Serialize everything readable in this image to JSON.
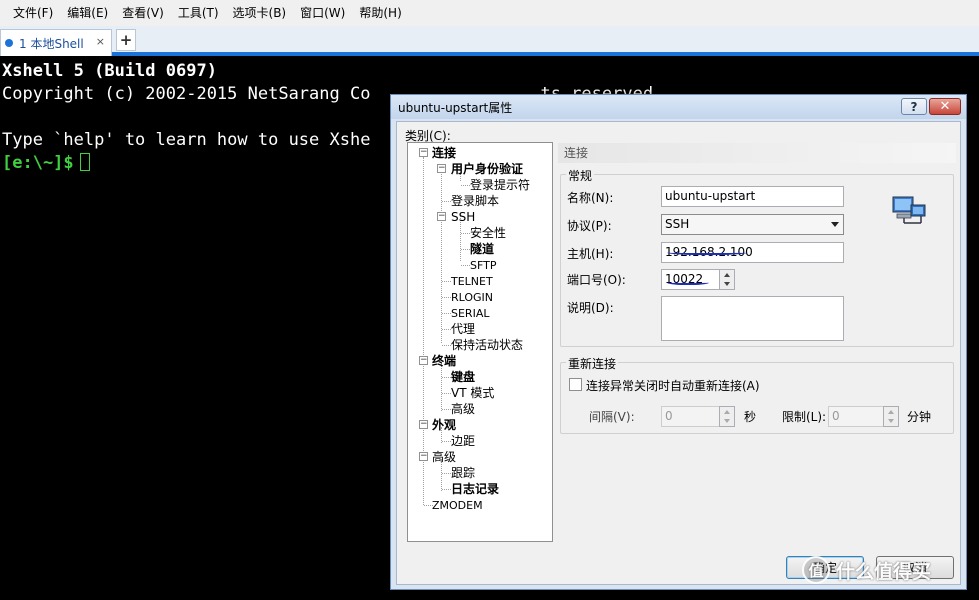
{
  "menu": [
    "文件(F)",
    "编辑(E)",
    "查看(V)",
    "工具(T)",
    "选项卡(B)",
    "窗口(W)",
    "帮助(H)"
  ],
  "tab": {
    "label": "1 本地Shell",
    "close": "×",
    "add": "+"
  },
  "terminal": {
    "line1": "Xshell 5 (Build 0697)",
    "line2": "Copyright (c) 2002-2015 NetSarang Co",
    "line2_tail": "ts reserved.",
    "line3": "Type `help' to learn how to use Xshe",
    "prompt": "[e:\\~]$"
  },
  "dialog": {
    "title": "ubuntu-upstart属性",
    "help": "?",
    "close": "✕",
    "category_label": "类别(C):",
    "tree": [
      "连接",
      "用户身份验证",
      "登录提示符",
      "登录脚本",
      "SSH",
      "安全性",
      "隧道",
      "SFTP",
      "TELNET",
      "RLOGIN",
      "SERIAL",
      "代理",
      "保持活动状态",
      "终端",
      "键盘",
      "VT 模式",
      "高级",
      "外观",
      "边距",
      "高级",
      "跟踪",
      "日志记录",
      "ZMODEM"
    ],
    "section_title": "连接",
    "general": {
      "title": "常规",
      "name_label": "名称(N):",
      "name_value": "ubuntu-upstart",
      "protocol_label": "协议(P):",
      "protocol_value": "SSH",
      "host_label": "主机(H):",
      "host_value": "192.168.2.100",
      "port_label": "端口号(O):",
      "port_value": "10022",
      "desc_label": "说明(D):"
    },
    "reconnect": {
      "title": "重新连接",
      "checkbox_label": "连接异常关闭时自动重新连接(A)",
      "interval_label": "间隔(V):",
      "interval_value": "0",
      "interval_unit": "秒",
      "limit_label": "限制(L):",
      "limit_value": "0",
      "limit_unit": "分钟"
    },
    "ok_label": "确定",
    "cancel_label": "取消"
  },
  "watermark": {
    "logo": "值",
    "text": "什么值得买"
  },
  "colors": {
    "accent": "#1b73d8",
    "prompt": "#3fcf3f",
    "annotation": "#1c2fb8"
  }
}
